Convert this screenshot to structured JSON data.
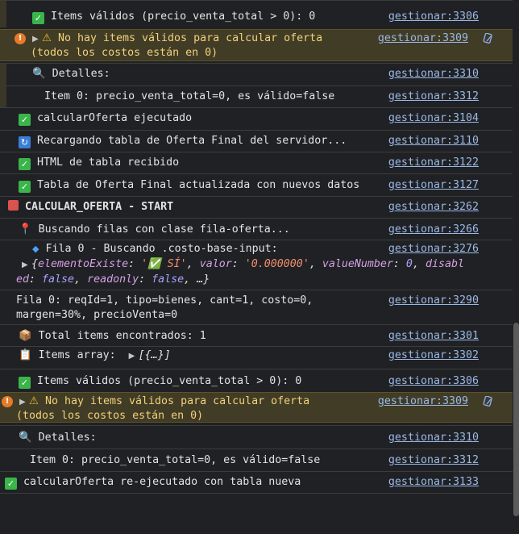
{
  "rows": [
    {
      "text": "Items válidos (precio_venta_total > 0): 0",
      "link": "gestionar:3306"
    },
    {
      "text": "No hay items válidos para calcular oferta",
      "text2": "(todos los costos están en 0)",
      "link": "gestionar:3309"
    },
    {
      "text": "Detalles:",
      "link": "gestionar:3310"
    },
    {
      "text": "Item 0: precio_venta_total=0, es válido=false",
      "link": "gestionar:3312"
    },
    {
      "text": "calcularOferta ejecutado",
      "link": "gestionar:3104"
    },
    {
      "text": "Recargando tabla de Oferta Final del servidor...",
      "link": "gestionar:3110"
    },
    {
      "text": "HTML de tabla recibido",
      "link": "gestionar:3122"
    },
    {
      "text": "Tabla de Oferta Final actualizada con nuevos datos",
      "link": "gestionar:3127"
    },
    {
      "text": "CALCULAR_OFERTA - START",
      "link": "gestionar:3262"
    },
    {
      "text": "Buscando filas con clase fila-oferta...",
      "link": "gestionar:3266"
    },
    {
      "text": "Fila 0 - Buscando .costo-base-input:",
      "link": "gestionar:3276"
    },
    {
      "text": "Fila 0: reqId=1, tipo=bienes, cant=1, costo=0,",
      "text2": "margen=30%, precioVenta=0",
      "link": "gestionar:3290"
    },
    {
      "text": "Total items encontrados: 1",
      "link": "gestionar:3301"
    },
    {
      "text": "Items array:",
      "link": "gestionar:3302"
    },
    {
      "text": "Items válidos (precio_venta_total > 0): 0",
      "link": "gestionar:3306"
    },
    {
      "text": "No hay items válidos para calcular oferta",
      "text2": "(todos los costos están en 0)",
      "link": "gestionar:3309"
    },
    {
      "text": "Detalles:",
      "link": "gestionar:3310"
    },
    {
      "text": "Item 0: precio_venta_total=0, es válido=false",
      "link": "gestionar:3312"
    },
    {
      "text": "calcularOferta re-ejecutado con tabla nueva",
      "link": "gestionar:3133"
    }
  ],
  "object_preview": {
    "line1_pre": "{",
    "key1": "elementoExiste",
    "val1": "'✅ SÍ'",
    "key2": "valor",
    "val2": "'0.000000'",
    "key3": "valueNumber",
    "val3": "0",
    "key4_part": "disabl",
    "key4_rest": "ed",
    "val4": "false",
    "key5": "readonly",
    "val5": "false",
    "tail": "…}"
  },
  "items_array_preview": "[{…}]",
  "colors": {
    "background": "#202124",
    "link": "#9ab8e6",
    "warning_bg": "#413c26",
    "warning_text": "#f2d17a"
  }
}
